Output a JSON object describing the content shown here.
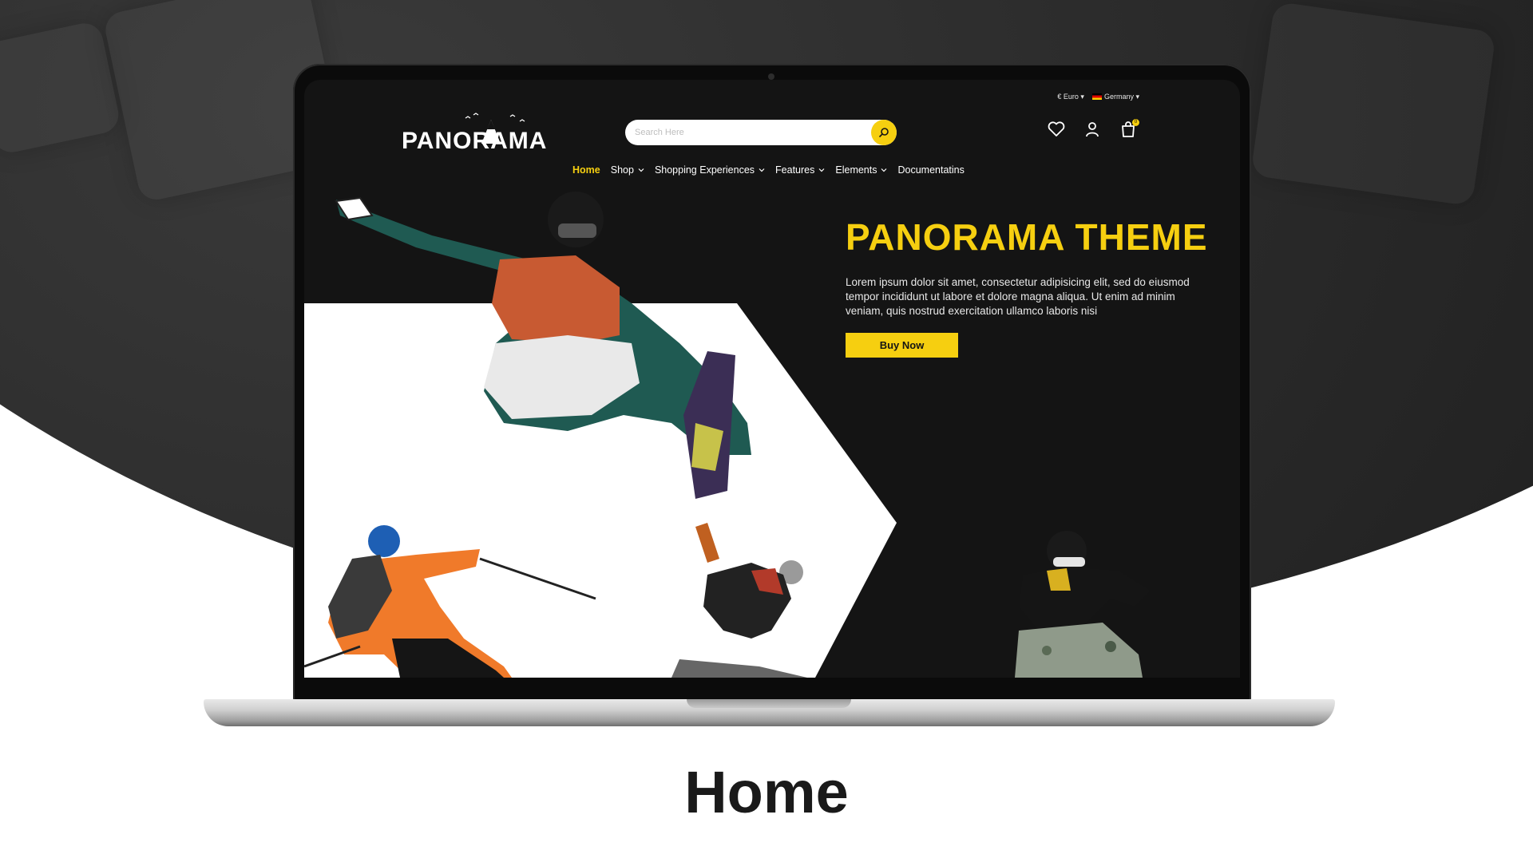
{
  "site": {
    "logo_text": "PANORAMA",
    "currency": "€ Euro",
    "country": "Germany",
    "search_placeholder": "Search Here",
    "cart_count": "0",
    "nav": [
      {
        "label": "Home",
        "active": true
      },
      {
        "label": "Shop",
        "has_dropdown": true
      },
      {
        "label": "Shopping Experiences",
        "has_dropdown": true
      },
      {
        "label": "Features",
        "has_dropdown": true
      },
      {
        "label": "Elements",
        "has_dropdown": true
      },
      {
        "label": "Documentatins",
        "has_dropdown": false
      }
    ]
  },
  "hero": {
    "title": "PANORAMA THEME",
    "text": "Lorem ipsum dolor sit amet, consectetur adipisicing elit, sed do eiusmod tempor incididunt ut labore et dolore magna aliqua. Ut enim ad minim veniam, quis nostrud exercitation ullamco laboris nisi",
    "button": "Buy Now"
  },
  "caption": "Home",
  "colors": {
    "accent": "#f6cf10",
    "site_bg": "#141414",
    "page_bg": "#ffffff"
  },
  "icons": [
    "search-icon",
    "heart-icon",
    "user-icon",
    "cart-icon",
    "chevron-down-icon"
  ]
}
